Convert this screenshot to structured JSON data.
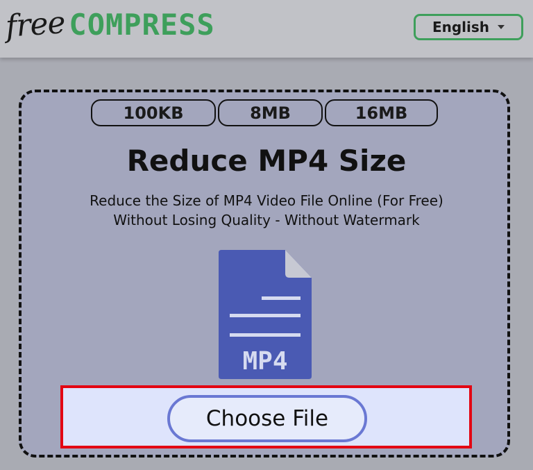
{
  "header": {
    "logo_free": "free",
    "logo_compress": "COMPRESS",
    "language": "English"
  },
  "size_options": [
    "100KB",
    "8MB",
    "16MB"
  ],
  "main": {
    "title": "Reduce MP4 Size",
    "subtitle_line1": "Reduce the Size of MP4 Video File Online (For Free)",
    "subtitle_line2": "Without Losing Quality - Without Watermark",
    "file_label": "MP4",
    "choose_button": "Choose File"
  },
  "colors": {
    "brand_green": "#3e9f5b",
    "file_blue": "#4a5ab3",
    "highlight_red": "#e30613"
  },
  "icons": {
    "file": "mp4-file-icon",
    "dropdown": "chevron-down-icon"
  }
}
